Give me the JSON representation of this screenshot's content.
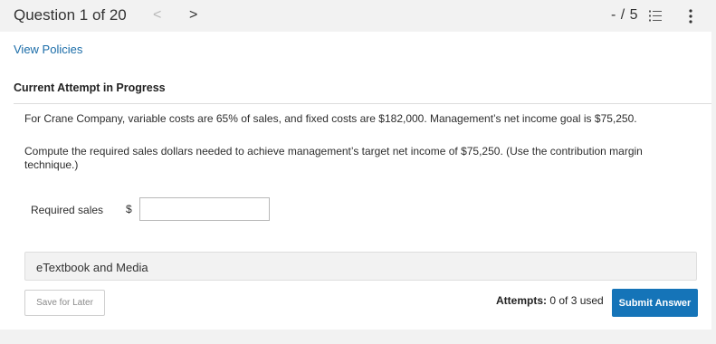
{
  "header": {
    "question_label": "Question 1 of 20",
    "prev_glyph": "<",
    "next_glyph": ">",
    "score": "- / 5",
    "list_icon": "list-icon",
    "more_icon": "more-vertical-icon"
  },
  "policies_link": "View Policies",
  "attempt_heading": "Current Attempt in Progress",
  "question": {
    "paragraph1": "For Crane Company, variable costs are 65% of sales, and fixed costs are $182,000. Management’s net income goal is $75,250.",
    "paragraph2": "Compute the required sales dollars needed to achieve management’s target net income of $75,250. (Use the contribution margin technique.)"
  },
  "answer": {
    "label": "Required sales",
    "currency": "$",
    "value": ""
  },
  "etextbook_label": "eTextbook and Media",
  "footer": {
    "save_label": "Save for Later",
    "attempts_label": "Attempts:",
    "attempts_value": "0 of 3 used",
    "submit_label": "Submit Answer"
  },
  "colors": {
    "accent": "#1574b8",
    "link": "#1a6ca8",
    "background": "#f2f2f2"
  }
}
